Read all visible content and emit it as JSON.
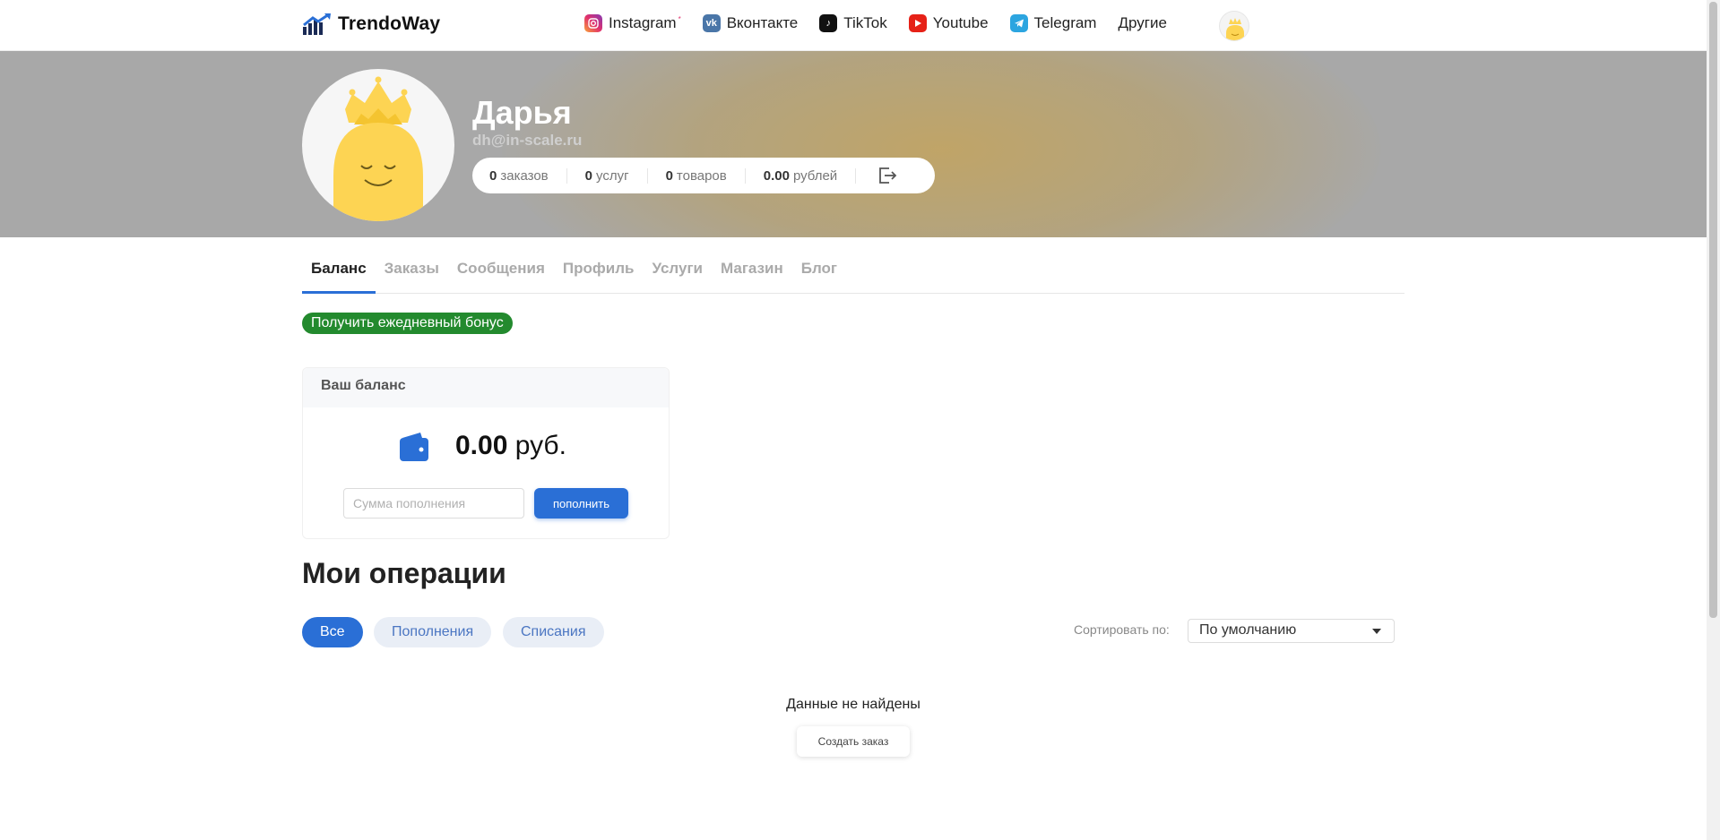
{
  "brand": {
    "name": "TrendoWay"
  },
  "nav": {
    "items": [
      {
        "label": "Instagram",
        "icon": "instagram-icon",
        "sup": "*"
      },
      {
        "label": "Вконтакте",
        "icon": "vk-icon"
      },
      {
        "label": "TikTok",
        "icon": "tiktok-icon"
      },
      {
        "label": "Youtube",
        "icon": "youtube-icon"
      },
      {
        "label": "Telegram",
        "icon": "telegram-icon"
      },
      {
        "label": "Другие"
      }
    ]
  },
  "profile": {
    "name": "Дарья",
    "email": "dh@in-scale.ru",
    "stats": {
      "orders_num": "0",
      "orders_label": "заказов",
      "services_num": "0",
      "services_label": "услуг",
      "goods_num": "0",
      "goods_label": "товаров",
      "money_num": "0.00",
      "money_label": "рублей"
    }
  },
  "tabs": [
    "Баланс",
    "Заказы",
    "Сообщения",
    "Профиль",
    "Услуги",
    "Магазин",
    "Блог"
  ],
  "bonus_label": "Получить ежедневный бонус",
  "balance": {
    "title": "Ваш баланс",
    "amount": "0.00",
    "currency": "руб.",
    "input_placeholder": "Сумма пополнения",
    "topup_label": "пополнить"
  },
  "operations": {
    "title": "Мои операции",
    "filters": [
      "Все",
      "Пополнения",
      "Списания"
    ],
    "sort_label": "Сортировать по:",
    "sort_value": "По умолчанию",
    "empty_text": "Данные не найдены",
    "create_label": "Создать заказ"
  },
  "colors": {
    "accent": "#2a6fd6",
    "bonus": "#238a2e",
    "hero": "#a8a8a8",
    "mascot": "#fdd453"
  }
}
